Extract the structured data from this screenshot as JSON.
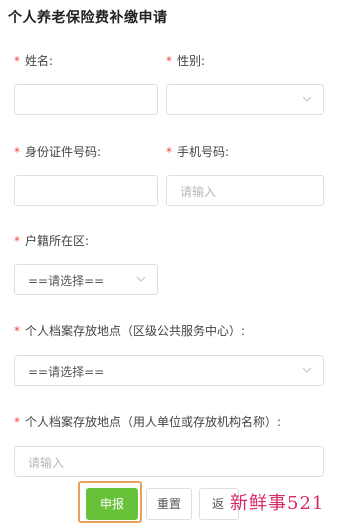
{
  "form": {
    "title": "个人养老保险费补缴申请",
    "required_mark": "*",
    "name": {
      "label": "姓名:",
      "value": ""
    },
    "gender": {
      "label": "性别:",
      "value": ""
    },
    "id_number": {
      "label": "身份证件号码:",
      "value": ""
    },
    "phone": {
      "label": "手机号码:",
      "placeholder": "请输入"
    },
    "household_district": {
      "label": "户籍所在区:",
      "value": "==请选择=="
    },
    "archive_location_public": {
      "label": "个人档案存放地点（区级公共服务中心）:",
      "value": "==请选择=="
    },
    "archive_location_employer": {
      "label": "个人档案存放地点（用人单位或存放机构名称）:",
      "placeholder": "请输入"
    }
  },
  "buttons": {
    "submit": "申报",
    "reset": "重置",
    "back": "返"
  },
  "watermark": "新鲜事521",
  "colors": {
    "primary": "#67c23a",
    "required": "#f04848",
    "border": "#dcdfe6",
    "watermark": "#d8286a",
    "focus_frame": "#e9a05a"
  }
}
